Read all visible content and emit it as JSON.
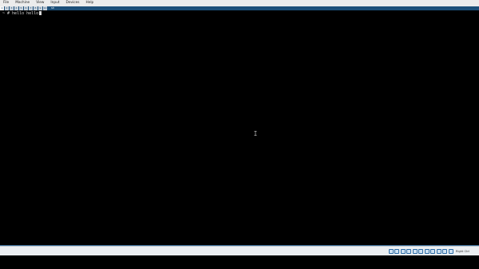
{
  "menubar": {
    "items": [
      "File",
      "Machine",
      "View",
      "Input",
      "Devices",
      "Help"
    ]
  },
  "tabstrip": {
    "tabs": [
      "1",
      "2",
      "3",
      "4",
      "5",
      "6",
      "7",
      "8",
      "9",
      "10"
    ],
    "active_label": "sh"
  },
  "terminal": {
    "prompt": "~ # ",
    "command": "hello hello"
  },
  "statusbar": {
    "host_key": "Right Ctrl"
  },
  "colors": {
    "menubar_bg": "#ececec",
    "tabstrip_bg": "#1c4f79",
    "terminal_bg": "#000000",
    "terminal_fg": "#d8d8d8",
    "statusbar_bg": "#eceff2"
  }
}
